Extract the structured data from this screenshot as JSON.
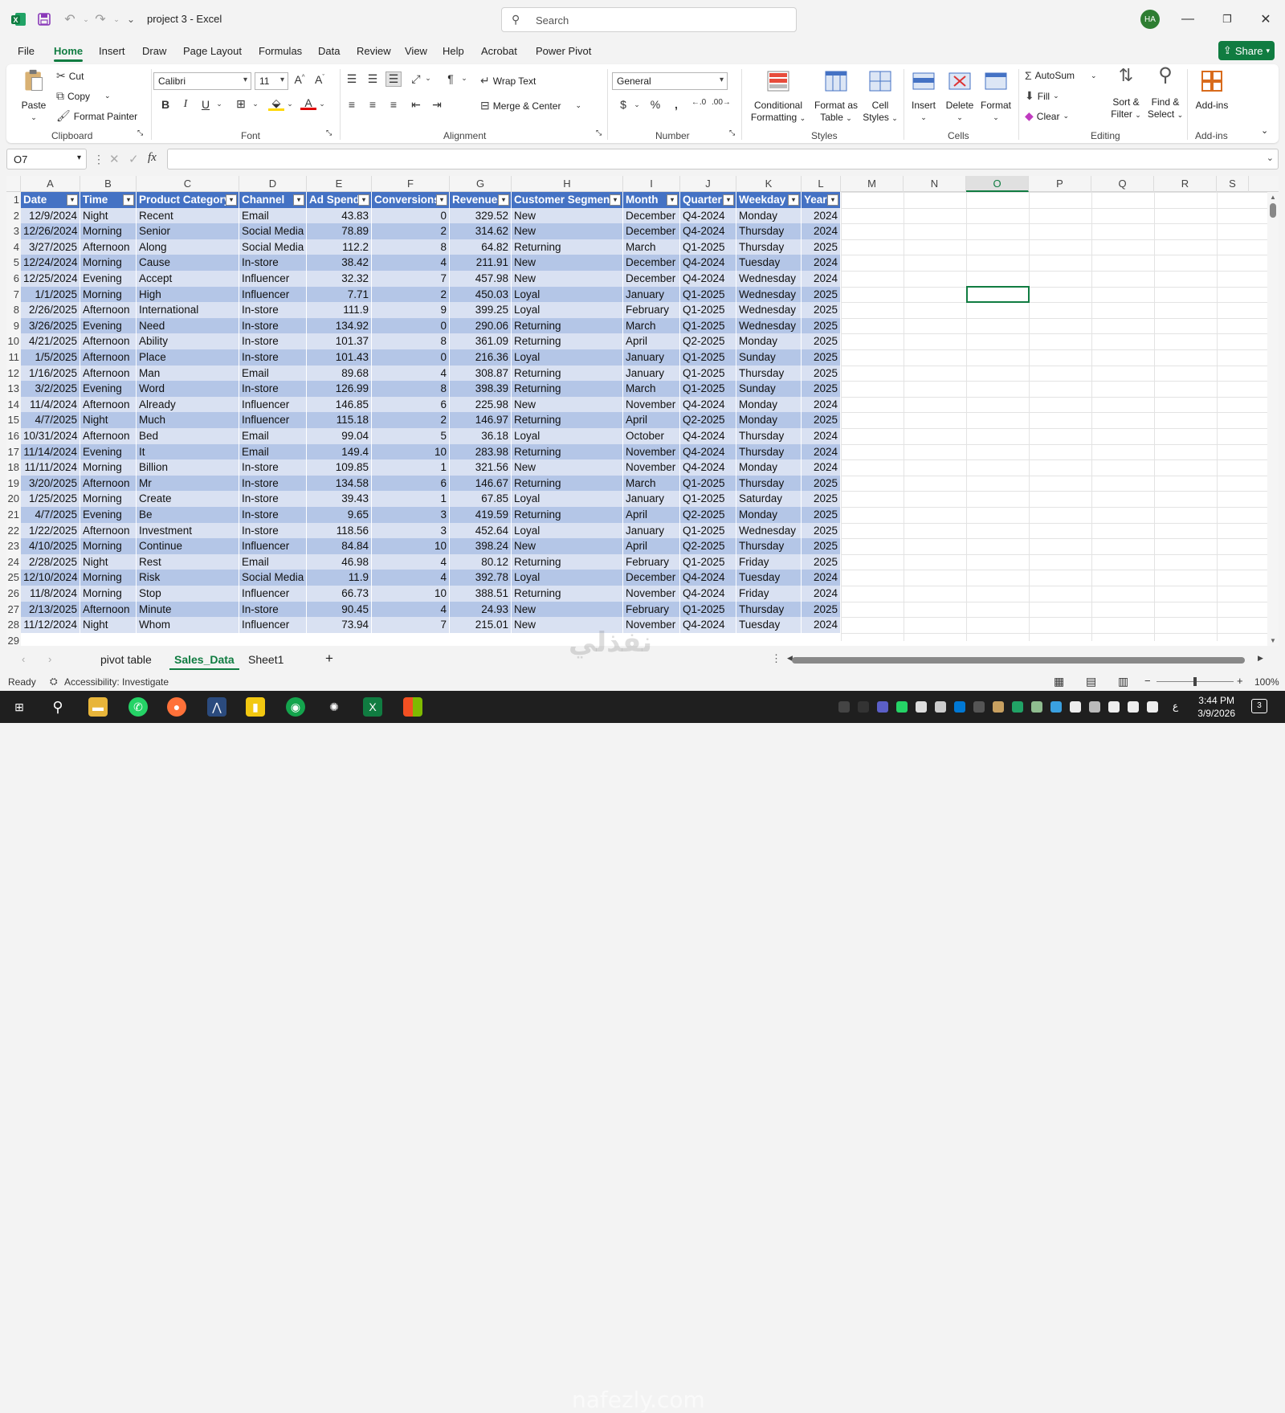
{
  "window": {
    "doc_title": "project 3 - Excel",
    "search_placeholder": "Search",
    "avatar_initials": "HA"
  },
  "menu": {
    "tabs": [
      "File",
      "Home",
      "Insert",
      "Draw",
      "Page Layout",
      "Formulas",
      "Data",
      "Review",
      "View",
      "Help",
      "Acrobat",
      "Power Pivot"
    ],
    "active": "Home",
    "share": "Share"
  },
  "ribbon": {
    "clipboard": {
      "paste": "Paste",
      "cut": "Cut",
      "copy": "Copy",
      "format_painter": "Format Painter",
      "label": "Clipboard"
    },
    "font": {
      "name": "Calibri",
      "size": "11",
      "label": "Font"
    },
    "alignment": {
      "wrap_text": "Wrap Text",
      "merge_center": "Merge & Center",
      "label": "Alignment"
    },
    "number": {
      "format": "General",
      "label": "Number"
    },
    "styles": {
      "conditional": [
        "Conditional",
        "Formatting"
      ],
      "format_table": [
        "Format as",
        "Table"
      ],
      "cell_styles": [
        "Cell",
        "Styles"
      ],
      "label": "Styles"
    },
    "cells": {
      "insert": "Insert",
      "delete": "Delete",
      "format": "Format",
      "label": "Cells"
    },
    "editing": {
      "autosum": "AutoSum",
      "fill": "Fill",
      "clear": "Clear",
      "sort_filter": [
        "Sort &",
        "Filter"
      ],
      "find_select": [
        "Find &",
        "Select"
      ],
      "label": "Editing"
    },
    "addins": {
      "addins": "Add-ins",
      "label": "Add-ins"
    }
  },
  "formula_bar": {
    "name_box": "O7",
    "fx": "fx",
    "value": ""
  },
  "grid": {
    "columns": [
      "A",
      "B",
      "C",
      "D",
      "E",
      "F",
      "G",
      "H",
      "I",
      "J",
      "K",
      "L",
      "M",
      "N",
      "O",
      "P",
      "Q",
      "R",
      "S"
    ],
    "selected_column": "O",
    "selected_cell": "O7",
    "headers": [
      "Date",
      "Time",
      "Product Category",
      "Channel",
      "Ad Spend",
      "Conversions",
      "Revenue",
      "Customer Segment",
      "Month",
      "Quarter",
      "Weekday",
      "Year"
    ],
    "rows": [
      [
        "12/9/2024",
        "Night",
        "Recent",
        "Email",
        "43.83",
        "0",
        "329.52",
        "New",
        "December",
        "Q4-2024",
        "Monday",
        "2024"
      ],
      [
        "12/26/2024",
        "Morning",
        "Senior",
        "Social Media",
        "78.89",
        "2",
        "314.62",
        "New",
        "December",
        "Q4-2024",
        "Thursday",
        "2024"
      ],
      [
        "3/27/2025",
        "Afternoon",
        "Along",
        "Social Media",
        "112.2",
        "8",
        "64.82",
        "Returning",
        "March",
        "Q1-2025",
        "Thursday",
        "2025"
      ],
      [
        "12/24/2024",
        "Morning",
        "Cause",
        "In-store",
        "38.42",
        "4",
        "211.91",
        "New",
        "December",
        "Q4-2024",
        "Tuesday",
        "2024"
      ],
      [
        "12/25/2024",
        "Evening",
        "Accept",
        "Influencer",
        "32.32",
        "7",
        "457.98",
        "New",
        "December",
        "Q4-2024",
        "Wednesday",
        "2024"
      ],
      [
        "1/1/2025",
        "Morning",
        "High",
        "Influencer",
        "7.71",
        "2",
        "450.03",
        "Loyal",
        "January",
        "Q1-2025",
        "Wednesday",
        "2025"
      ],
      [
        "2/26/2025",
        "Afternoon",
        "International",
        "In-store",
        "111.9",
        "9",
        "399.25",
        "Loyal",
        "February",
        "Q1-2025",
        "Wednesday",
        "2025"
      ],
      [
        "3/26/2025",
        "Evening",
        "Need",
        "In-store",
        "134.92",
        "0",
        "290.06",
        "Returning",
        "March",
        "Q1-2025",
        "Wednesday",
        "2025"
      ],
      [
        "4/21/2025",
        "Afternoon",
        "Ability",
        "In-store",
        "101.37",
        "8",
        "361.09",
        "Returning",
        "April",
        "Q2-2025",
        "Monday",
        "2025"
      ],
      [
        "1/5/2025",
        "Afternoon",
        "Place",
        "In-store",
        "101.43",
        "0",
        "216.36",
        "Loyal",
        "January",
        "Q1-2025",
        "Sunday",
        "2025"
      ],
      [
        "1/16/2025",
        "Afternoon",
        "Man",
        "Email",
        "89.68",
        "4",
        "308.87",
        "Returning",
        "January",
        "Q1-2025",
        "Thursday",
        "2025"
      ],
      [
        "3/2/2025",
        "Evening",
        "Word",
        "In-store",
        "126.99",
        "8",
        "398.39",
        "Returning",
        "March",
        "Q1-2025",
        "Sunday",
        "2025"
      ],
      [
        "11/4/2024",
        "Afternoon",
        "Already",
        "Influencer",
        "146.85",
        "6",
        "225.98",
        "New",
        "November",
        "Q4-2024",
        "Monday",
        "2024"
      ],
      [
        "4/7/2025",
        "Night",
        "Much",
        "Influencer",
        "115.18",
        "2",
        "146.97",
        "Returning",
        "April",
        "Q2-2025",
        "Monday",
        "2025"
      ],
      [
        "10/31/2024",
        "Afternoon",
        "Bed",
        "Email",
        "99.04",
        "5",
        "36.18",
        "Loyal",
        "October",
        "Q4-2024",
        "Thursday",
        "2024"
      ],
      [
        "11/14/2024",
        "Evening",
        "It",
        "Email",
        "149.4",
        "10",
        "283.98",
        "Returning",
        "November",
        "Q4-2024",
        "Thursday",
        "2024"
      ],
      [
        "11/11/2024",
        "Morning",
        "Billion",
        "In-store",
        "109.85",
        "1",
        "321.56",
        "New",
        "November",
        "Q4-2024",
        "Monday",
        "2024"
      ],
      [
        "3/20/2025",
        "Afternoon",
        "Mr",
        "In-store",
        "134.58",
        "6",
        "146.67",
        "Returning",
        "March",
        "Q1-2025",
        "Thursday",
        "2025"
      ],
      [
        "1/25/2025",
        "Morning",
        "Create",
        "In-store",
        "39.43",
        "1",
        "67.85",
        "Loyal",
        "January",
        "Q1-2025",
        "Saturday",
        "2025"
      ],
      [
        "4/7/2025",
        "Evening",
        "Be",
        "In-store",
        "9.65",
        "3",
        "419.59",
        "Returning",
        "April",
        "Q2-2025",
        "Monday",
        "2025"
      ],
      [
        "1/22/2025",
        "Afternoon",
        "Investment",
        "In-store",
        "118.56",
        "3",
        "452.64",
        "Loyal",
        "January",
        "Q1-2025",
        "Wednesday",
        "2025"
      ],
      [
        "4/10/2025",
        "Morning",
        "Continue",
        "Influencer",
        "84.84",
        "10",
        "398.24",
        "New",
        "April",
        "Q2-2025",
        "Thursday",
        "2025"
      ],
      [
        "2/28/2025",
        "Night",
        "Rest",
        "Email",
        "46.98",
        "4",
        "80.12",
        "Returning",
        "February",
        "Q1-2025",
        "Friday",
        "2025"
      ],
      [
        "12/10/2024",
        "Morning",
        "Risk",
        "Social Media",
        "11.9",
        "4",
        "392.78",
        "Loyal",
        "December",
        "Q4-2024",
        "Tuesday",
        "2024"
      ],
      [
        "11/8/2024",
        "Morning",
        "Stop",
        "Influencer",
        "66.73",
        "10",
        "388.51",
        "Returning",
        "November",
        "Q4-2024",
        "Friday",
        "2024"
      ],
      [
        "2/13/2025",
        "Afternoon",
        "Minute",
        "In-store",
        "90.45",
        "4",
        "24.93",
        "New",
        "February",
        "Q1-2025",
        "Thursday",
        "2025"
      ],
      [
        "11/12/2024",
        "Night",
        "Whom",
        "Influencer",
        "73.94",
        "7",
        "215.01",
        "New",
        "November",
        "Q4-2024",
        "Tuesday",
        "2024"
      ]
    ]
  },
  "sheets": {
    "tabs": [
      "pivot table",
      "Sales_Data",
      "Sheet1"
    ],
    "active": "Sales_Data",
    "add": "+"
  },
  "status": {
    "ready": "Ready",
    "accessibility": "Accessibility: Investigate",
    "zoom": "100%"
  },
  "taskbar": {
    "time": "3:44 PM",
    "date": "3/9/2026",
    "notifications": "3"
  },
  "watermark": {
    "arabic": "نفذلي",
    "site": "nafezly.com"
  },
  "colors": {
    "accent": "#107c41",
    "table_header": "#4472c4",
    "band_light": "#d9e1f2",
    "band_dark": "#b4c6e7"
  }
}
